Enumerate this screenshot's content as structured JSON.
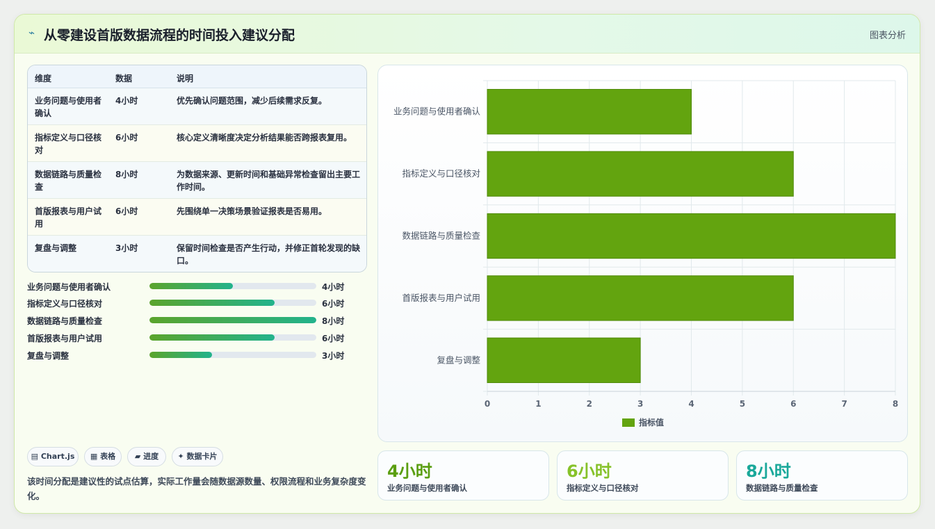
{
  "header": {
    "icon": "spark-icon",
    "title": "从零建设首版数据流程的时间投入建议分配",
    "tag": "图表分析"
  },
  "table": {
    "headers": [
      "维度",
      "数据",
      "说明"
    ],
    "rows": [
      {
        "dim": "业务问题与使用者确认",
        "val": "4小时",
        "desc": "优先确认问题范围，减少后续需求反复。"
      },
      {
        "dim": "指标定义与口径核对",
        "val": "6小时",
        "desc": "核心定义清晰度决定分析结果能否跨报表复用。"
      },
      {
        "dim": "数据链路与质量检查",
        "val": "8小时",
        "desc": "为数据来源、更新时间和基础异常检查留出主要工作时间。"
      },
      {
        "dim": "首版报表与用户试用",
        "val": "6小时",
        "desc": "先围绕单一决策场景验证报表是否易用。"
      },
      {
        "dim": "复盘与调整",
        "val": "3小时",
        "desc": "保留时间检查是否产生行动，并修正首轮发现的缺口。"
      }
    ]
  },
  "progress": {
    "max": 8,
    "items": [
      {
        "label": "业务问题与使用者确认",
        "value": 4,
        "text": "4小时"
      },
      {
        "label": "指标定义与口径核对",
        "value": 6,
        "text": "6小时"
      },
      {
        "label": "数据链路与质量检查",
        "value": 8,
        "text": "8小时"
      },
      {
        "label": "首版报表与用户试用",
        "value": 6,
        "text": "6小时"
      },
      {
        "label": "复盘与调整",
        "value": 3,
        "text": "3小时"
      }
    ]
  },
  "chips": [
    {
      "icon": "chart-icon",
      "glyph": "▤",
      "label": "Chart.js"
    },
    {
      "icon": "table-icon",
      "glyph": "▦",
      "label": "表格"
    },
    {
      "icon": "progress-icon",
      "glyph": "▰",
      "label": "进度"
    },
    {
      "icon": "sparkle-icon",
      "glyph": "✦",
      "label": "数据卡片"
    }
  ],
  "note": "该时间分配是建议性的试点估算，实际工作量会随数据源数量、权限流程和业务复杂度变化。",
  "stats": [
    {
      "value": "4小时",
      "label": "业务问题与使用者确认",
      "color": "#5a9e10"
    },
    {
      "value": "6小时",
      "label": "指标定义与口径核对",
      "color": "#86c22a"
    },
    {
      "value": "8小时",
      "label": "数据链路与质量检查",
      "color": "#1aa89a"
    }
  ],
  "chart_data": {
    "type": "bar",
    "orientation": "horizontal",
    "categories": [
      "业务问题与使用者确认",
      "指标定义与口径核对",
      "数据链路与质量检查",
      "首版报表与用户试用",
      "复盘与调整"
    ],
    "series": [
      {
        "name": "指标值",
        "values": [
          4,
          6,
          8,
          6,
          3
        ]
      }
    ],
    "xlim": [
      0,
      8
    ],
    "xticks": [
      0,
      1,
      2,
      3,
      4,
      5,
      6,
      7,
      8
    ],
    "grid": true,
    "legend": "bottom",
    "bar_color": "#63a40f"
  }
}
